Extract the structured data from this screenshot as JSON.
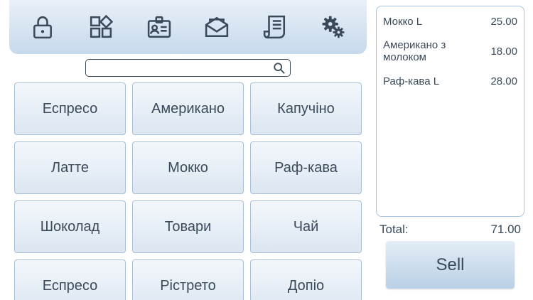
{
  "toolbar": {
    "icons": [
      "lock-icon",
      "widgets-icon",
      "id-badge-icon",
      "mail-open-icon",
      "receipt-icon",
      "gears-icon"
    ]
  },
  "search": {
    "value": "",
    "placeholder": ""
  },
  "products": [
    {
      "label": "Еспресо"
    },
    {
      "label": "Американо"
    },
    {
      "label": "Капучіно"
    },
    {
      "label": "Латте"
    },
    {
      "label": "Мокко"
    },
    {
      "label": "Раф-кава"
    },
    {
      "label": "Шоколад"
    },
    {
      "label": "Товари"
    },
    {
      "label": "Чай"
    },
    {
      "label": "Еспресо"
    },
    {
      "label": "Рістрето"
    },
    {
      "label": "Допіо"
    }
  ],
  "receipt": {
    "items": [
      {
        "name": "Мокко L",
        "price": "25.00"
      },
      {
        "name": "Американо з молоком",
        "price": "18.00"
      },
      {
        "name": "Раф-кава L",
        "price": "28.00"
      }
    ]
  },
  "total": {
    "label": "Total:",
    "value": "71.00"
  },
  "sell_label": "Sell",
  "colors": {
    "icon": "#3a4a5a",
    "toolbar_top": "#e9f0f8",
    "toolbar_bottom": "#c6d9ec",
    "border": "#a8bfd6"
  }
}
